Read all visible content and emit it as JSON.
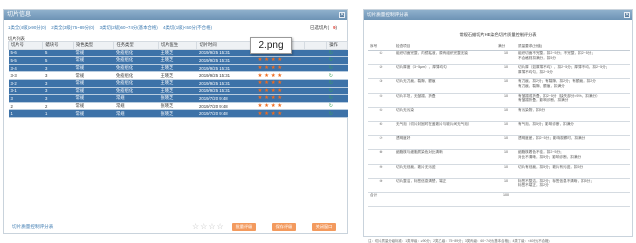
{
  "left_window": {
    "title": "切片信息",
    "close_icon": "close-icon",
    "filters": [
      "1类全(4级)≥90分(0)",
      "2类全(3级)75~89分(0)",
      "3类切(2级)60~74分(基本合格)",
      "4类切(1级)<60分(不合格)"
    ],
    "selected_label": "已选切片(",
    "selected_count": "9",
    "selected_suffix": ")",
    "section_label": "切片列表",
    "columns": [
      "切片号",
      "蜡块号",
      "染色类型",
      "任务类型",
      "切片医生",
      "切片时间",
      "切片质量评价",
      "",
      "操作"
    ],
    "rows": [
      {
        "slide": "5-6",
        "block": "5",
        "stain": "常规",
        "task": "免疫组化",
        "doctor": "王晓芝",
        "time": "2019/9/25 15:31",
        "stars": 4,
        "selected": true
      },
      {
        "slide": "5-5",
        "block": "5",
        "stain": "常规",
        "task": "免疫组化",
        "doctor": "王晓芝",
        "time": "2019/9/25 15:31",
        "stars": 4,
        "selected": true
      },
      {
        "slide": "3-4",
        "block": "3",
        "stain": "常规",
        "task": "免疫组化",
        "doctor": "王晓芝",
        "time": "2019/9/25 15:31",
        "stars": 4,
        "selected": true
      },
      {
        "slide": "3-3",
        "block": "3",
        "stain": "常规",
        "task": "免疫组化",
        "doctor": "王晓芝",
        "time": "2019/9/25 15:31",
        "stars": 4,
        "selected": false
      },
      {
        "slide": "3-2",
        "block": "3",
        "stain": "常规",
        "task": "免疫组化",
        "doctor": "王晓芝",
        "time": "2019/9/25 15:31",
        "stars": 4,
        "selected": true
      },
      {
        "slide": "3-1",
        "block": "3",
        "stain": "常规",
        "task": "免疫组化",
        "doctor": "王晓芝",
        "time": "2019/9/25 15:31",
        "stars": 4,
        "selected": true
      },
      {
        "slide": "3",
        "block": "3",
        "stain": "常规",
        "task": "常规",
        "doctor": "张晓芝",
        "time": "2019/7/20 9:48",
        "stars": 4,
        "selected": true
      },
      {
        "slide": "2",
        "block": "2",
        "stain": "常规",
        "task": "常规",
        "doctor": "张晓芝",
        "time": "2019/7/20 9:48",
        "stars": 4,
        "selected": false
      },
      {
        "slide": "1",
        "block": "1",
        "stain": "常规",
        "task": "常规",
        "doctor": "张晓芝",
        "time": "2019/7/20 9:48",
        "stars": 4,
        "selected": true
      }
    ],
    "star_glyph": "★",
    "op_icon_glyph": "↻",
    "footer_link": "切片质量控制评分表",
    "footer_stars": "☆☆☆☆",
    "buttons": [
      "批量评级",
      "保存评级",
      "关闭窗口"
    ],
    "colors": {
      "selected_row": "#3d72a8",
      "star": "#f06b1e",
      "button": "#f39a5e",
      "link": "#3c7ab0",
      "count": "#d9362b"
    }
  },
  "popup_text": "2.png",
  "right_window": {
    "title": "切片质量控制评分表",
    "doc_heading": "常规石蜡切片HE染色切片质量控制评分表",
    "columns": [
      "序号",
      "检查项目",
      "满分",
      "质量要求(分值)"
    ],
    "rows": [
      {
        "no": "①",
        "item": "组织切面完整，内镜粘液，原有组织完整无缺",
        "score": "10",
        "req": "组织切面不完整，扣2~5分；不完整，扣2~5分；\n不合格则扣满分，扣5分"
      },
      {
        "no": "②",
        "item": "切片厚度（3~5μm），厚薄均匀",
        "score": "10",
        "req": "切片厚（如厚薄不均），扣2~5分；厚薄不均，扣2~5分；\n厚薄不均匀，扣2~5分"
      },
      {
        "no": "③",
        "item": "切片无刀痕，裂隙，颤痕",
        "score": "10",
        "req": "有刀痕，扣2分；有裂隙，扣2分；有颤痕，扣2分\n有刀痕、裂隙、颤痕，扣满分"
      },
      {
        "no": "④",
        "item": "切片平坦，无皱褶，折叠",
        "score": "10",
        "req": "有皱褶或折叠，扣2~5分（缺失部分>5%，扣满分）\n有皱褶折叠，影响诊断，扣满分"
      },
      {
        "no": "⑤",
        "item": "切片无污染",
        "score": "10",
        "req": "有污染物，扣5分"
      },
      {
        "no": "⑥",
        "item": "无气泡（切片封固时在盖玻片与玻片间无气泡）",
        "score": "10",
        "req": "有气泡，扣5分；影响诊断，扣满分"
      },
      {
        "no": "⑦",
        "item": "透明度好",
        "score": "10",
        "req": "透明度差，扣2~5分；影响观察时，扣满分"
      },
      {
        "no": "⑧",
        "item": "细胞核与细胞质染色对比清晰",
        "score": "10",
        "req": "细胞核着色不佳，扣2~5分；\n对比不清晰，扣5分；影响诊断，扣满分"
      },
      {
        "no": "⑨",
        "item": "切片无划痕，玻片无污迹",
        "score": "10",
        "req": "切片有划痕，扣5分；玻片有污迹，扣5分"
      },
      {
        "no": "⑩",
        "item": "切片整洁，标签信息清楚，端正",
        "score": "10",
        "req": "标签不整洁，扣2分；标签信息不清晰，扣5分；\n标签不端正，扣2分"
      }
    ],
    "total_label": "合计",
    "total_score": "100",
    "footnote": "注：切片质量分级标准：1类甲级：≥90分；2类乙级：75~89分；3类丙级：60~74分(基本合格)；4类丁级：<60分(不合格)"
  }
}
